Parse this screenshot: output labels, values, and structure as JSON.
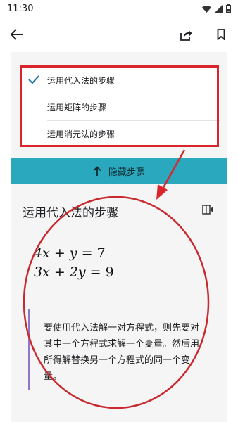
{
  "status_bar": {
    "time": "11:30",
    "icons": [
      "wifi-icon",
      "signal-icon",
      "battery-icon"
    ]
  },
  "toolbar": {
    "back_icon": "back-arrow-icon",
    "share_icon": "share-icon",
    "bookmark_icon": "bookmark-icon"
  },
  "methods": {
    "items": [
      {
        "label": "运用代入法的步骤",
        "selected": true
      },
      {
        "label": "运用矩阵的步骤",
        "selected": false
      },
      {
        "label": "运用消元法的步骤",
        "selected": false
      }
    ]
  },
  "hide_steps": {
    "label": "隐藏步骤",
    "icon": "arrow-up-icon"
  },
  "section": {
    "title": "运用代入法的步骤",
    "read_icon": "read-aloud-icon",
    "equations": [
      {
        "lhs": "4x + y",
        "rhs": "7"
      },
      {
        "lhs": "3x + 2y",
        "rhs": "9"
      }
    ],
    "explanation": "要使用代入法解一对方程式，则先要对其中一个方程式求解一个变量。然后用所得解替换另一个方程式的同一个变量。"
  },
  "colors": {
    "accent": "#2aa8bd",
    "annotation_red": "#d9252b",
    "check": "#1a73a8",
    "quote_bar": "#8e77c9",
    "content_bg": "#f5f5f5"
  }
}
